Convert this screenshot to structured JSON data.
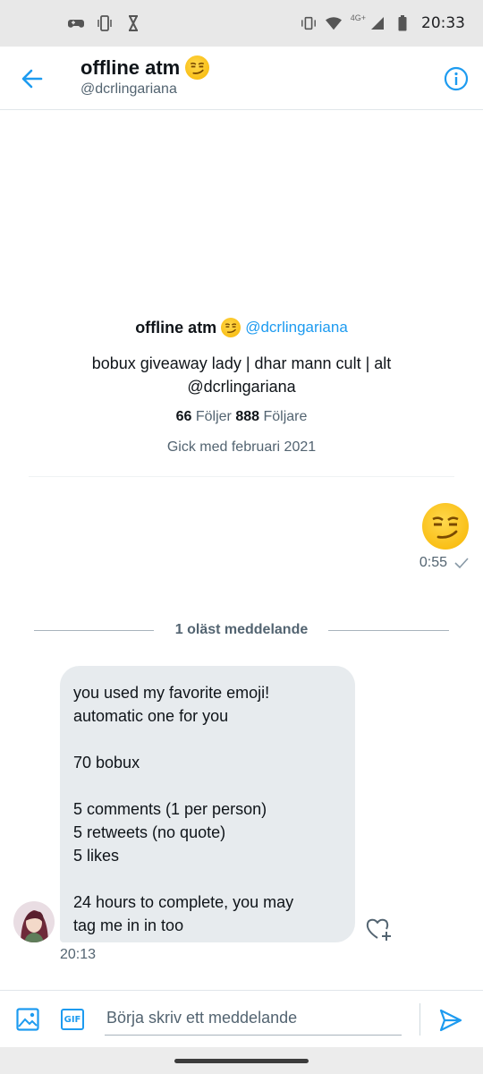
{
  "status_bar": {
    "time": "20:33",
    "network": "4G+",
    "left_icons": [
      "game-controller-icon",
      "phone-vibrate-icon",
      "hourglass-icon"
    ],
    "right_icons": [
      "vibrate-icon",
      "wifi-icon",
      "signal-icon",
      "battery-icon"
    ]
  },
  "header": {
    "title": "offline atm",
    "handle": "@dcrlingariana",
    "back_icon": "arrow-left-icon",
    "info_icon": "info-icon"
  },
  "profile": {
    "name": "offline atm",
    "handle": "@dcrlingariana",
    "bio_line1": "bobux giveaway lady | dhar mann cult | alt",
    "bio_line2": "@dcrlingariana",
    "following_count": "66",
    "following_label": "Följer",
    "followers_count": "888",
    "followers_label": "Följare",
    "joined": "Gick med februari 2021"
  },
  "sent_message": {
    "content_icon": "smirking-face-emoji",
    "time": "0:55",
    "status_icon": "check-icon"
  },
  "unread_divider": {
    "label": "1 oläst meddelande"
  },
  "received_message": {
    "lines": [
      "you used my favorite emoji!",
      "automatic one for you",
      "",
      "70 bobux",
      "",
      "5 comments (1 per person)",
      "5 retweets (no quote)",
      "5 likes",
      "",
      "24 hours to complete, you may",
      "tag me in in too"
    ],
    "time": "20:13",
    "reaction_icon": "heart-plus-icon"
  },
  "composer": {
    "placeholder": "Börja skriv ett meddelande",
    "value": "",
    "gif_label": "GIF",
    "image_icon": "image-icon",
    "send_icon": "send-icon"
  },
  "colors": {
    "accent": "#1d9bf0",
    "secondary_text": "#536471",
    "bubble": "#e7ebee",
    "status_bar": "#e8e8e8"
  }
}
